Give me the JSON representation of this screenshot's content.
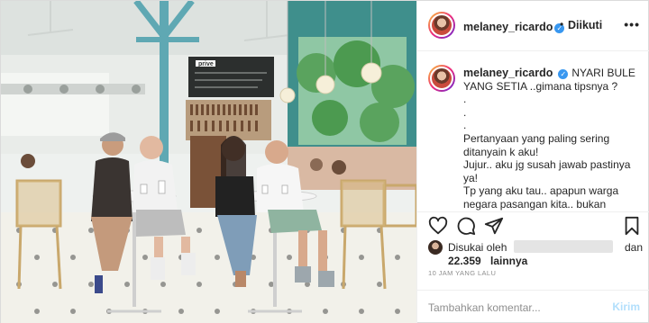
{
  "post": {
    "username": "melaney_ricardo",
    "verified_mark": "✓",
    "separator": "•",
    "follow_status": "Diikuti",
    "more_icon": "•••",
    "caption_username": "melaney_ricardo",
    "caption_text": "NYARI BULE YANG SETIA ..gimana tipsnya ?\n.\n.\n.\nPertanyaan yang paling sering ditanyain k aku!\nJujur.. aku jg susah jawab pastinya ya!\nTp yang aku tau.. apapun warga negara pasangan kita.. bukan jaminan!!"
  },
  "actions": {
    "like_icon": "heart-icon",
    "comment_icon": "comment-icon",
    "share_icon": "share-icon",
    "save_icon": "bookmark-icon"
  },
  "likes": {
    "prefix": "Disukai oleh",
    "and": "dan",
    "count": "22.359",
    "others": "lainnya"
  },
  "timestamp": "10 JAM YANG LALU",
  "comment": {
    "placeholder": "Tambahkan komentar...",
    "post_label": "Kirim"
  },
  "photo": {
    "menu_board_text": "prive"
  }
}
